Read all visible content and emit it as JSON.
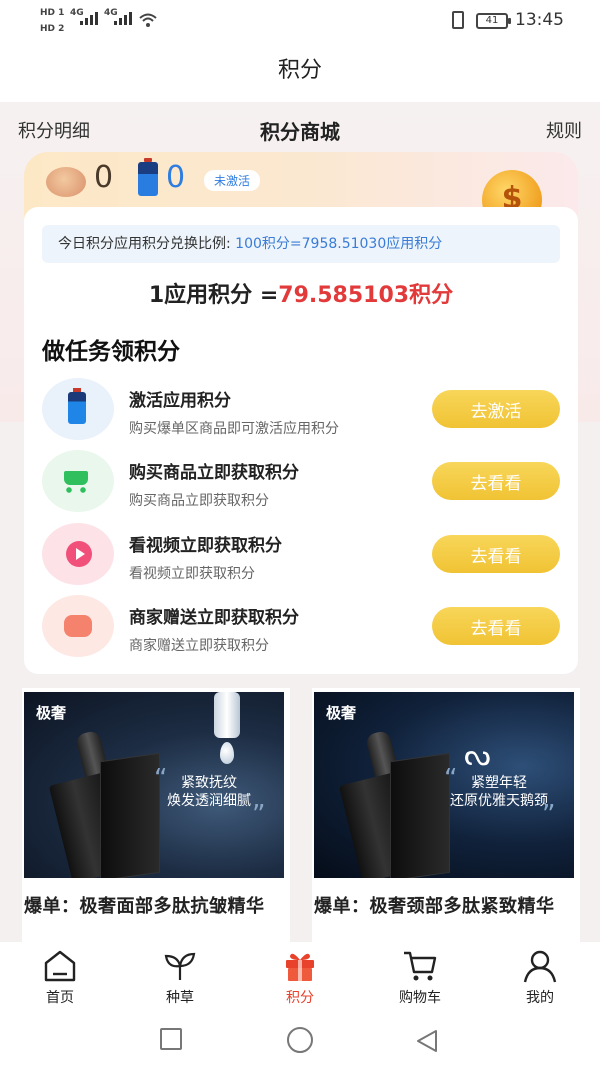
{
  "status": {
    "sim1": "HD 1",
    "sim2": "HD 2",
    "network1": "4G",
    "network2": "4G",
    "battery_level": "41",
    "time": "13:45"
  },
  "header": {
    "title": "积分"
  },
  "nav": {
    "left": "积分明细",
    "center": "积分商城",
    "right": "规则"
  },
  "points": {
    "points_value": "0",
    "app_points_value": "0",
    "status_badge": "未激活",
    "coin_symbol": "$"
  },
  "rate": {
    "label": "今日积分应用积分兑换比例:",
    "value": "100积分=7958.51030应用积分",
    "app_rate_prefix": "1应用积分 =",
    "app_rate_value": "79.585103积分"
  },
  "tasks": {
    "heading": "做任务领积分",
    "items": [
      {
        "title": "激活应用积分",
        "desc": "购买爆单区商品即可激活应用积分",
        "button": "去激活",
        "icon": "battery-icon"
      },
      {
        "title": "购买商品立即获取积分",
        "desc": "购买商品立即获取积分",
        "button": "去看看",
        "icon": "cart-icon"
      },
      {
        "title": "看视频立即获取积分",
        "desc": "看视频立即获取积分",
        "button": "去看看",
        "icon": "video-play-icon"
      },
      {
        "title": "商家赠送立即获取积分",
        "desc": "商家赠送立即获取积分",
        "button": "去看看",
        "icon": "gift-icon"
      }
    ]
  },
  "products": [
    {
      "brand": "极奢",
      "slogan_line1": "紧致抚纹",
      "slogan_line2": "焕发透润细腻",
      "name": "爆单：极奢面部多肽抗皱精华"
    },
    {
      "brand": "极奢",
      "slogan_line1": "紧塑年轻",
      "slogan_line2": "还原优雅天鹅颈",
      "name": "爆单：极奢颈部多肽紧致精华"
    }
  ],
  "tabbar": {
    "items": [
      {
        "label": "首页",
        "icon": "home-icon"
      },
      {
        "label": "种草",
        "icon": "sprout-icon"
      },
      {
        "label": "积分",
        "icon": "gift-box-icon"
      },
      {
        "label": "购物车",
        "icon": "shopping-cart-icon"
      },
      {
        "label": "我的",
        "icon": "user-icon"
      }
    ],
    "active": "积分"
  },
  "colors": {
    "accent_red": "#e8412c",
    "rate_blue": "#3a7cd6",
    "button_yellow": "#f0c334"
  }
}
